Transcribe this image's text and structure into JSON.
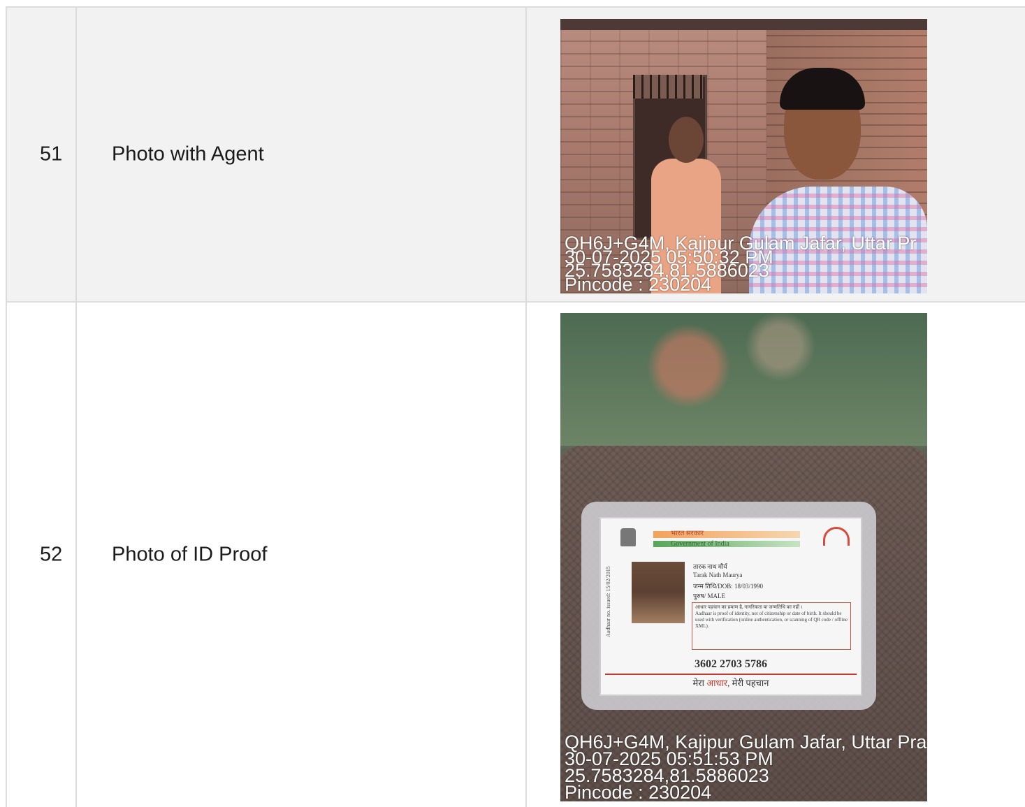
{
  "rows": [
    {
      "number": "51",
      "label": "Photo with Agent",
      "photo": {
        "stamp_location": "QH6J+G4M, Kajipur Gulam Jafar, Uttar Pr",
        "stamp_datetime": "30-07-2025 05:50:32 PM",
        "stamp_coords": "25.7583284,81.5886023",
        "stamp_pincode": "Pincode : 230204"
      }
    },
    {
      "number": "52",
      "label": "Photo of ID Proof",
      "photo": {
        "stamp_location": "QH6J+G4M, Kajipur Gulam Jafar, Uttar Pra",
        "stamp_datetime": "30-07-2025 05:51:53 PM",
        "stamp_coords": "25.7583284,81.5886023",
        "stamp_pincode": "Pincode : 230204",
        "id_card": {
          "header_hindi": "भारत सरकार",
          "header_english": "Government of India",
          "name_hindi": "तारक नाथ मौर्य",
          "name_english": "Tarak Nath Maurya",
          "dob": "जन्म तिथि/DOB: 18/03/1990",
          "gender": "पुरुष/ MALE",
          "side_text": "Aadhaar no. issued: 15/02/2015",
          "notice_hindi": "आधार पहचान का प्रमाण है, नागरिकता या जन्मतिथि का नहीं ।",
          "notice_english": "Aadhaar is proof of identity, not of citizenship or date of birth. It should be used with verification (online authentication, or scanning of QR code / offline XML).",
          "number": "3602 2703 5786",
          "footer_part1": "मेरा",
          "footer_part2": "आधार",
          "footer_part3": ", मेरी पहचान"
        }
      }
    }
  ]
}
